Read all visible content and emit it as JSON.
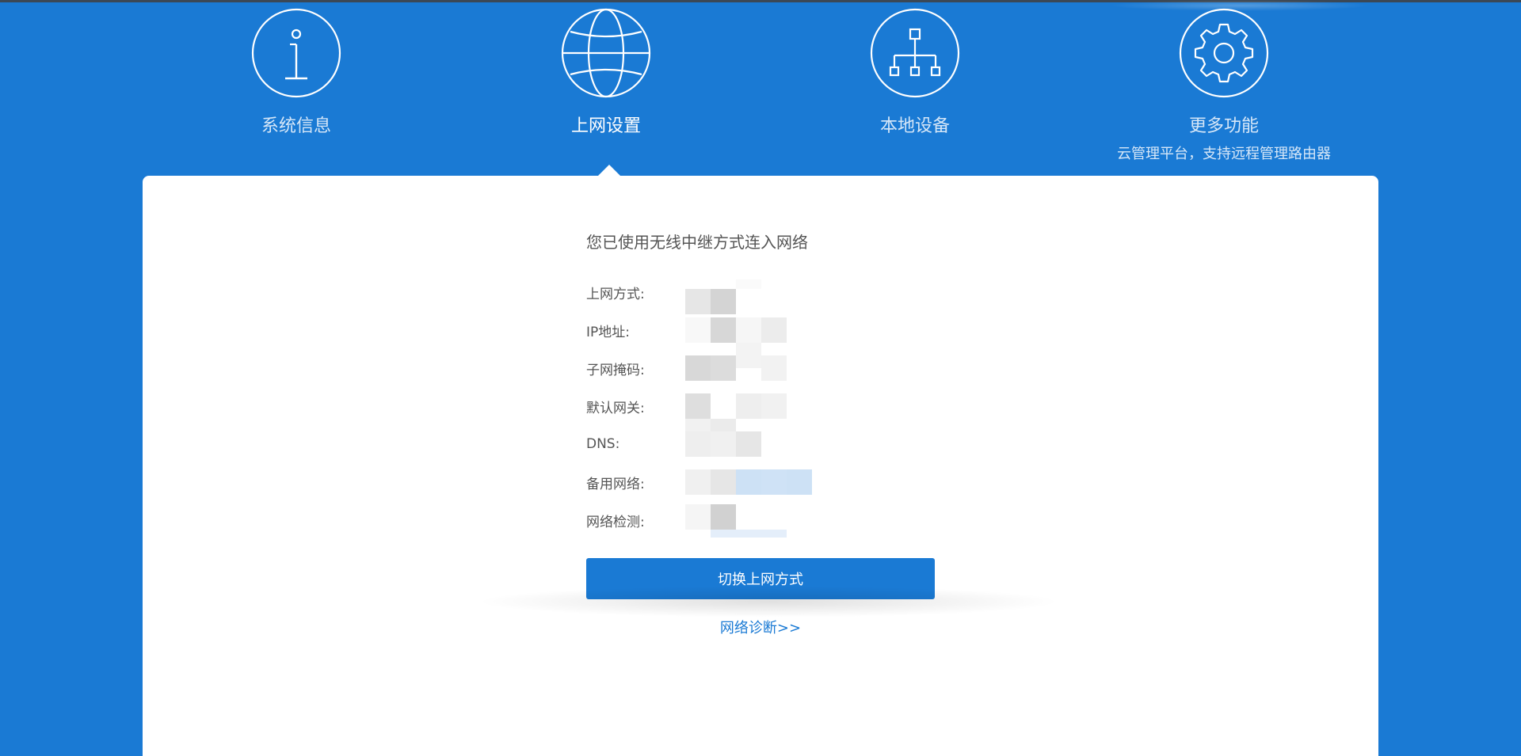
{
  "nav": {
    "items": [
      {
        "label": "系统信息",
        "icon": "info-icon",
        "active": false
      },
      {
        "label": "上网设置",
        "icon": "globe-icon",
        "active": true
      },
      {
        "label": "本地设备",
        "icon": "network-tree-icon",
        "active": false
      },
      {
        "label": "更多功能",
        "sublabel": "云管理平台，支持远程管理路由器",
        "icon": "gear-icon",
        "active": false
      }
    ]
  },
  "panel": {
    "heading": "您已使用无线中继方式连入网络",
    "fields": [
      {
        "label": "上网方式:"
      },
      {
        "label": "IP地址:"
      },
      {
        "label": "子网掩码:"
      },
      {
        "label": "默认网关:"
      },
      {
        "label": "DNS:"
      },
      {
        "label": "备用网络:"
      },
      {
        "label": "网络检测:"
      }
    ],
    "switch_button_label": "切换上网方式",
    "diagnose_link": "网络诊断>>"
  },
  "colors": {
    "brand_blue": "#1a7ad4",
    "panel_bg": "#ffffff",
    "text_gray": "#555555"
  }
}
